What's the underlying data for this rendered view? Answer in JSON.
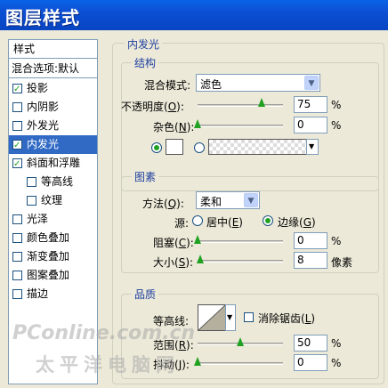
{
  "window": {
    "title": "图层样式"
  },
  "styles_list": {
    "header": "样式",
    "blend_options": "混合选项:默认",
    "items": [
      {
        "label": "投影",
        "checked": true
      },
      {
        "label": "内阴影",
        "checked": false
      },
      {
        "label": "外发光",
        "checked": false
      },
      {
        "label": "内发光",
        "checked": true,
        "selected": true
      },
      {
        "label": "斜面和浮雕",
        "checked": true
      },
      {
        "label": "等高线",
        "checked": false
      },
      {
        "label": "纹理",
        "checked": false
      },
      {
        "label": "光泽",
        "checked": false
      },
      {
        "label": "颜色叠加",
        "checked": false
      },
      {
        "label": "渐变叠加",
        "checked": false
      },
      {
        "label": "图案叠加",
        "checked": false
      },
      {
        "label": "描边",
        "checked": false
      }
    ]
  },
  "panel": {
    "title": "内发光",
    "structure": {
      "title": "结构",
      "blend_mode_label": "混合模式:",
      "blend_mode_value": "滤色",
      "opacity_label": "不透明度",
      "opacity_key": "O",
      "opacity_value": "75",
      "opacity_level": 0.75,
      "noise_label": "杂色",
      "noise_key": "N",
      "noise_value": "0",
      "noise_level": 0,
      "percent": "%"
    },
    "elements": {
      "title": "图素",
      "method_label": "方法",
      "method_key": "Q",
      "method_value": "柔和",
      "source_label": "源:",
      "center_label": "居中",
      "center_key": "E",
      "edge_label": "边缘",
      "edge_key": "G",
      "choke_label": "阻塞",
      "choke_key": "C",
      "choke_value": "0",
      "choke_level": 0,
      "size_label": "大小",
      "size_key": "S",
      "size_value": "8",
      "size_level": 0.032,
      "size_unit": "像素"
    },
    "quality": {
      "title": "品质",
      "contour_label": "等高线:",
      "antialias_label": "消除锯齿",
      "antialias_key": "L",
      "range_label": "范围",
      "range_key": "R",
      "range_value": "50",
      "range_level": 0.5,
      "jitter_label": "抖动",
      "jitter_key": "J",
      "jitter_value": "0",
      "jitter_level": 0,
      "percent": "%"
    }
  },
  "watermark": {
    "line1": "PConline.com.cn",
    "line2": "太平洋电脑网"
  },
  "colors": {
    "titlebar": "#0c4fd4",
    "selected": "#316ac5",
    "group_title": "#1e3fa0",
    "thumb": "#21a121"
  }
}
